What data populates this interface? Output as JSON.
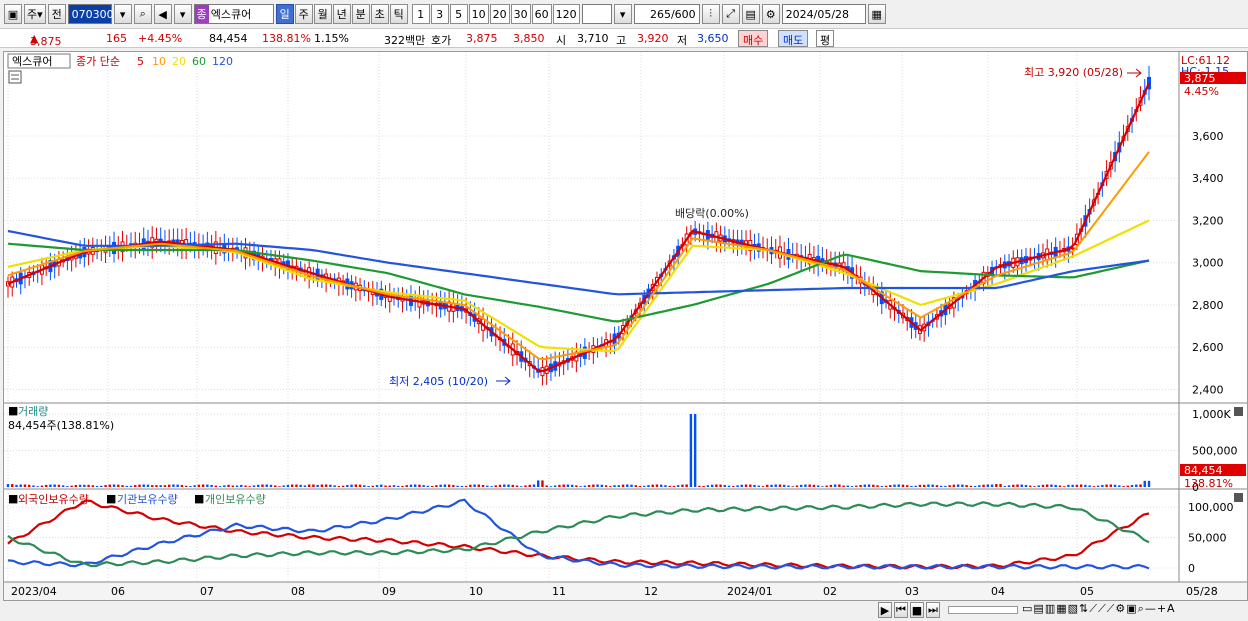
{
  "toolbar": {
    "market": "주",
    "prev": "전",
    "code": "070300",
    "stock_name": "엑스큐어",
    "badge": "종",
    "periods": [
      "일",
      "주",
      "월",
      "년",
      "분",
      "초",
      "틱"
    ],
    "selected_period": "일",
    "intervals": [
      "1",
      "3",
      "5",
      "10",
      "20",
      "30",
      "60",
      "120"
    ],
    "count": "265",
    "count_total": "/600",
    "date": "2024/05/28"
  },
  "quote": {
    "price": "3,875",
    "change": "165",
    "rate": "+4.45%",
    "volume": "84,454",
    "vol_ratio": "138.81%",
    "turnover": "1.15%",
    "amount": "322백만",
    "hoga_label": "호가",
    "ask": "3,875",
    "bid": "3,850",
    "open_label": "시",
    "open": "3,710",
    "high_label": "고",
    "high": "3,920",
    "low_label": "저",
    "low": "3,650",
    "buy": "매수",
    "sell": "매도",
    "eval": "평"
  },
  "price_panel": {
    "name": "엑스큐어",
    "ma_label": "종가 단순",
    "ma_periods": [
      "5",
      "10",
      "20",
      "60",
      "120"
    ],
    "ma_colors": [
      "#d40000",
      "#ff9a00",
      "#f0e000",
      "#1e9a32",
      "#2255dd"
    ],
    "lc": "LC:61.12",
    "hc": "HC:-1.15",
    "cur_price": "3,875",
    "cur_rate": "4.45%",
    "high_note": "최고 3,920 (05/28)",
    "low_note": "최저 2,405 (10/20)",
    "event_note": "배당락(0.00%)",
    "y_ticks": [
      "3,600",
      "3,400",
      "3,200",
      "3,000",
      "2,800",
      "2,600",
      "2,400"
    ]
  },
  "volume_panel": {
    "title": "거래량",
    "current": "84,454주(138.81%)",
    "y_ticks": [
      "1,000K",
      "500,000",
      "0"
    ],
    "cur_value": "84,454",
    "cur_ratio": "138.81%"
  },
  "holding_panel": {
    "legend": [
      "외국인보유수량",
      "기관보유수량",
      "개인보유수량"
    ],
    "colors": [
      "#d40000",
      "#2255dd",
      "#2e8b57"
    ],
    "y_ticks": [
      "100,000",
      "50,000",
      "0"
    ]
  },
  "x_axis": {
    "labels": [
      "2023/04",
      "06",
      "07",
      "08",
      "09",
      "10",
      "11",
      "12",
      "2024/01",
      "02",
      "03",
      "04",
      "05"
    ],
    "last_date": "05/28"
  },
  "chart_data": {
    "type": "line",
    "title": "",
    "series": [
      {
        "name": "5",
        "x": [
          "2023/04",
          "05",
          "06",
          "07",
          "08",
          "09",
          "10",
          "10/20",
          "11",
          "12",
          "2024/01",
          "02",
          "03",
          "04",
          "05",
          "05/28"
        ],
        "values": [
          2900,
          3050,
          3100,
          3060,
          2950,
          2840,
          2780,
          2480,
          2640,
          3150,
          3060,
          2980,
          2680,
          2980,
          3070,
          3850
        ]
      },
      {
        "name": "20",
        "x": [
          "2023/04",
          "05",
          "06",
          "07",
          "08",
          "09",
          "10",
          "10/20",
          "11",
          "12",
          "2024/01",
          "02",
          "03",
          "04",
          "05",
          "05/28"
        ],
        "values": [
          2980,
          3060,
          3080,
          3050,
          2920,
          2860,
          2820,
          2600,
          2580,
          3080,
          3060,
          2950,
          2800,
          2900,
          3030,
          3200
        ]
      },
      {
        "name": "60",
        "x": [
          "2023/04",
          "05",
          "06",
          "07",
          "08",
          "09",
          "10",
          "10/20",
          "11",
          "12",
          "2024/01",
          "02",
          "03",
          "04",
          "05",
          "05/28"
        ],
        "values": [
          3090,
          3060,
          3060,
          3060,
          3010,
          2950,
          2850,
          2790,
          2720,
          2800,
          2900,
          3040,
          2960,
          2940,
          2930,
          3010
        ]
      },
      {
        "name": "120",
        "x": [
          "2023/04",
          "05",
          "06",
          "07",
          "08",
          "09",
          "10",
          "10/20",
          "11",
          "12",
          "2024/01",
          "02",
          "03",
          "04",
          "05",
          "05/28"
        ],
        "values": [
          3150,
          3080,
          3080,
          3090,
          3060,
          3000,
          2950,
          2900,
          2850,
          2860,
          2870,
          2880,
          2880,
          2880,
          2960,
          3010
        ]
      }
    ],
    "volume": [
      40000,
      30000,
      25000,
      20000,
      35000,
      20000,
      15000,
      90000,
      25000,
      1000000,
      30000,
      20000,
      30000,
      40000,
      30000,
      84454
    ],
    "holdings": {
      "foreign": [
        40000,
        110000,
        80000,
        60000,
        50000,
        45000,
        35000,
        20000,
        10000,
        8000,
        5000,
        3000,
        2000,
        3000,
        20000,
        90000
      ],
      "institution": [
        10000,
        5000,
        40000,
        70000,
        60000,
        80000,
        110000,
        20000,
        5000,
        3000,
        2000,
        2000,
        2000,
        2000,
        2000,
        2000
      ],
      "individual": [
        50000,
        5000,
        10000,
        20000,
        25000,
        25000,
        30000,
        60000,
        85000,
        95000,
        98000,
        100000,
        105000,
        105000,
        100000,
        45000
      ]
    },
    "ylim": [
      2350,
      3950
    ]
  }
}
